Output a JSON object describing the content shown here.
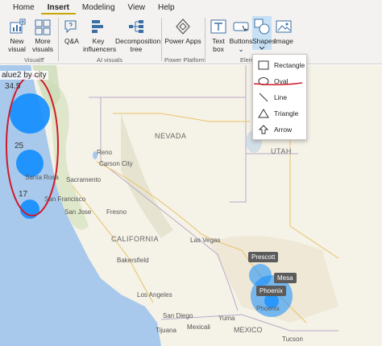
{
  "tabs": [
    {
      "label": "Home"
    },
    {
      "label": "Insert",
      "active": true
    },
    {
      "label": "Modeling"
    },
    {
      "label": "View"
    },
    {
      "label": "Help"
    }
  ],
  "ribbon": {
    "new_visual": "New visual",
    "more_visuals": "More visuals ⌄",
    "qa": "Q&A",
    "key_influencers": "Key influencers",
    "decomposition_tree": "Decomposition tree",
    "power_apps": "Power Apps",
    "text_box": "Text box",
    "buttons": "Buttons ⌄",
    "shapes": "Shapes",
    "image": "Image",
    "groups": {
      "visuals": "Visuals",
      "ai_visuals": "AI visuals",
      "power_platform": "Power Platform",
      "elements": "Eleme"
    }
  },
  "shapes_menu": {
    "items": [
      {
        "label": "Rectangle",
        "icon": "rectangle-icon"
      },
      {
        "label": "Oval",
        "icon": "oval-icon"
      },
      {
        "label": "Line",
        "icon": "line-icon"
      },
      {
        "label": "Triangle",
        "icon": "triangle-icon"
      },
      {
        "label": "Arrow",
        "icon": "arrow-icon"
      }
    ]
  },
  "map": {
    "title": "alue2 by city",
    "bubble_values": [
      "34.5",
      "25",
      "17"
    ],
    "tooltips": [
      "Prescott",
      "Mesa",
      "Phoenix"
    ],
    "labels": {
      "nevada": "NEVADA",
      "utah": "UTAH",
      "california": "CALIFORNIA",
      "mexico": "MEXICO",
      "carson_city": "Carson City",
      "sacramento": "Sacramento",
      "san_francisco": "San Francisco",
      "san_jose": "San Jose",
      "santa_rosa": "Santa Rosa",
      "las_vegas": "Las Vegas",
      "los_angeles": "Los Angeles",
      "san_diego": "San Diego",
      "tijuana": "Tijuana",
      "mexicali": "Mexicali",
      "yuma": "Yuma",
      "tucson": "Tucson",
      "fresno": "Fresno",
      "reno": "Reno",
      "bakersfield": "Bakersfield",
      "phoenix": "Phoenix"
    },
    "colors": {
      "bubble": "#118dff",
      "ocean": "#a8c9ec",
      "annotation": "#d11a2a"
    }
  }
}
